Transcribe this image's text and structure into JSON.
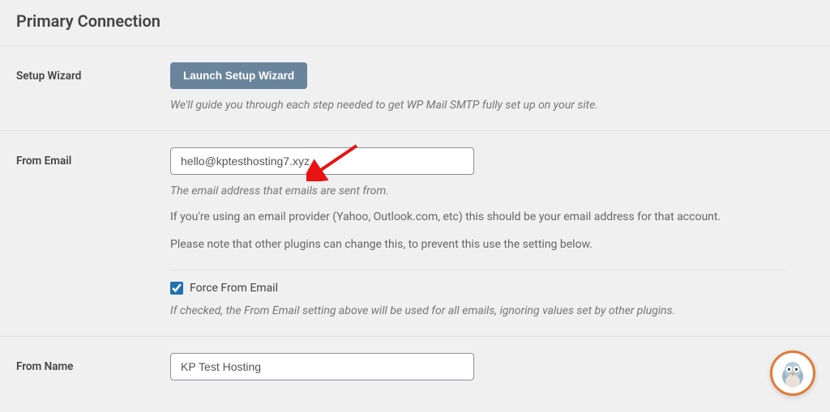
{
  "page": {
    "title": "Primary Connection"
  },
  "setupWizard": {
    "label": "Setup Wizard",
    "buttonLabel": "Launch Setup Wizard",
    "description": "We'll guide you through each step needed to get WP Mail SMTP fully set up on your site."
  },
  "fromEmail": {
    "label": "From Email",
    "value": "hello@kptesthosting7.xyz",
    "desc1": "The email address that emails are sent from.",
    "desc2": "If you're using an email provider (Yahoo, Outlook.com, etc) this should be your email address for that account.",
    "desc3": "Please note that other plugins can change this, to prevent this use the setting below.",
    "forceCheckboxLabel": "Force From Email",
    "forceChecked": true,
    "forceDesc": "If checked, the From Email setting above will be used for all emails, ignoring values set by other plugins."
  },
  "fromName": {
    "label": "From Name",
    "value": "KP Test Hosting"
  },
  "icons": {
    "helpAvatar": "pigeon-avatar-icon"
  }
}
